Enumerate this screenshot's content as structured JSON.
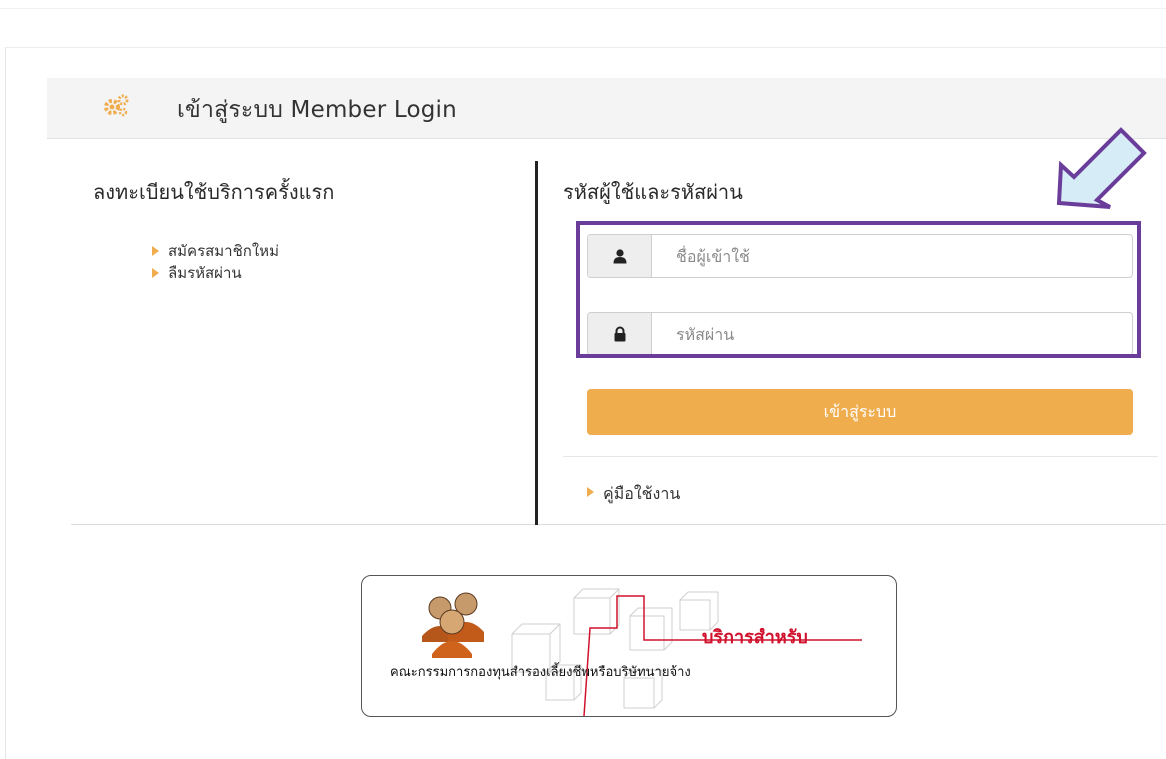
{
  "header": {
    "title": "เข้าสู่ระบบ Member Login"
  },
  "left": {
    "title": "ลงทะเบียนใช้บริการครั้งแรก",
    "links": [
      "สมัครสมาชิกใหม่",
      "ลืมรหัสผ่าน"
    ]
  },
  "right": {
    "title": "รหัสผู้ใช้และรหัสผ่าน",
    "username_placeholder": "ชื่อผู้เข้าใช้",
    "password_placeholder": "รหัสผ่าน",
    "login_label": "เข้าสู่ระบบ",
    "manual_link": "คู่มือใช้งาน"
  },
  "banner": {
    "title": "บริการสำหรับ",
    "subtitle": "คณะกรรมการกองทุนสำรองเลี้ยงชีพหรือบริษัทนายจ้าง"
  },
  "icons": {
    "header": "gears-icon",
    "username": "user-icon",
    "password": "lock-icon",
    "annotation": "arrow-icon",
    "banner": "people-icon"
  },
  "colors": {
    "accent": "#f0ad4e",
    "highlight": "#6a3d9a",
    "arrow_fill": "#d6ecf7",
    "banner_title": "#d0122d"
  }
}
